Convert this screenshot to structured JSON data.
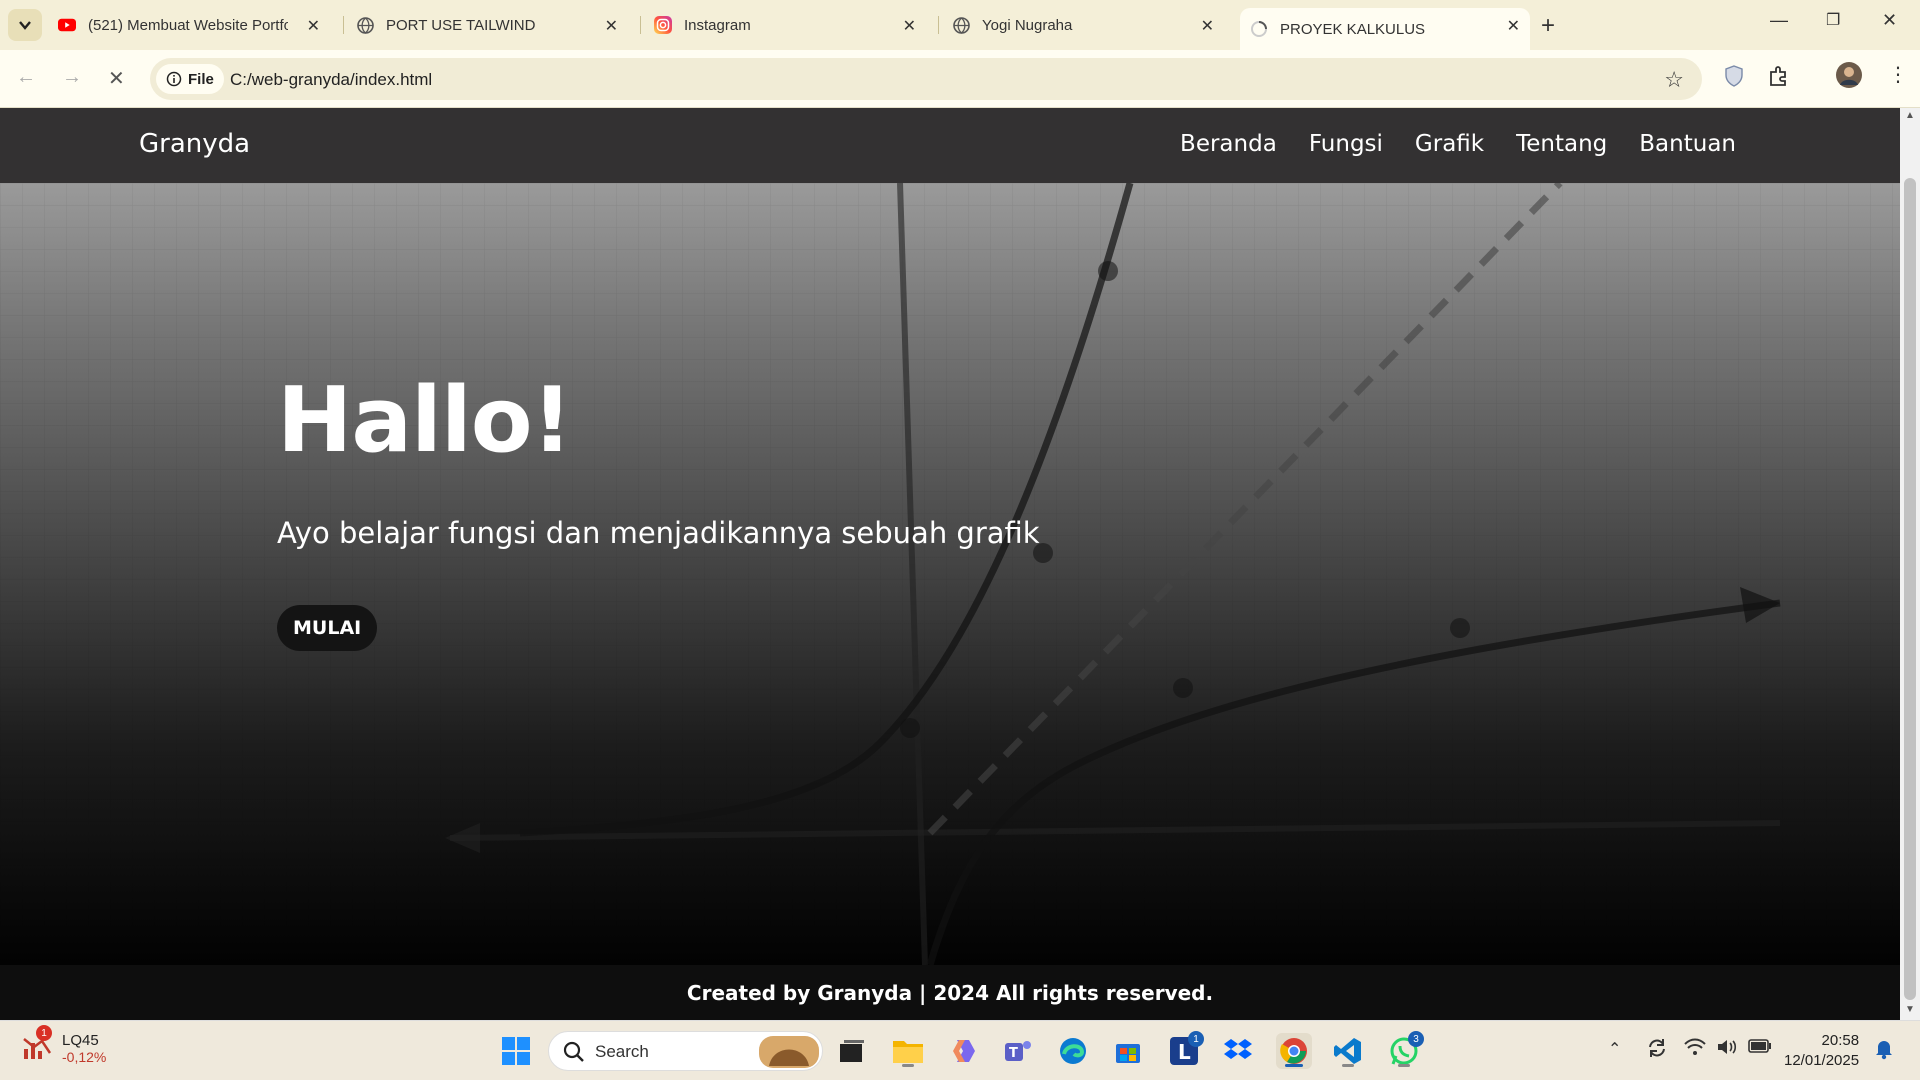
{
  "browser": {
    "tabs": [
      {
        "title": "(521) Membuat Website Portfol",
        "icon": "youtube-icon"
      },
      {
        "title": "PORT USE TAILWIND",
        "icon": "globe-icon"
      },
      {
        "title": "Instagram",
        "icon": "instagram-icon"
      },
      {
        "title": "Yogi Nugraha",
        "icon": "globe-icon"
      },
      {
        "title": "PROYEK KALKULUS",
        "icon": "loading-icon",
        "active": true
      }
    ],
    "address": {
      "chip": "File",
      "url": "C:/web-granyda/index.html"
    }
  },
  "site": {
    "brand": "Granyda",
    "menu": [
      "Beranda",
      "Fungsi",
      "Grafik",
      "Tentang",
      "Bantuan"
    ],
    "hero": {
      "title": "Hallo!",
      "subtitle": "Ayo belajar fungsi dan menjadikannya sebuah grafik",
      "cta": "MULAI"
    },
    "footer": "Created by Granyda | 2024 All rights reserved."
  },
  "taskbar": {
    "stock": {
      "name": "LQ45",
      "change": "-0,12%",
      "badge": "1"
    },
    "search": "Search",
    "badges": {
      "l_app": "1",
      "whatsapp": "3"
    },
    "clock": {
      "time": "20:58",
      "date": "12/01/2025"
    }
  }
}
